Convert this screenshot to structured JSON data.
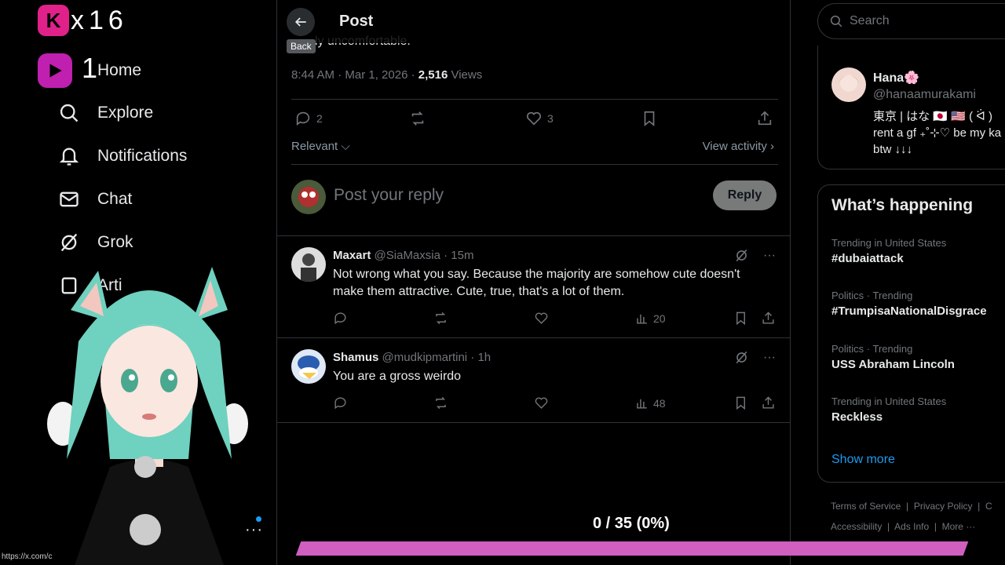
{
  "brand": {
    "letter": "K",
    "text": "x16",
    "badge_number": "1"
  },
  "nav": {
    "items": [
      {
        "label": "Home",
        "icon": "home-icon"
      },
      {
        "label": "Explore",
        "icon": "search-icon"
      },
      {
        "label": "Notifications",
        "icon": "bell-icon"
      },
      {
        "label": "Chat",
        "icon": "mail-icon"
      },
      {
        "label": "Grok",
        "icon": "grok-icon"
      },
      {
        "label": "Arti",
        "icon": "bookmark-icon"
      }
    ],
    "status_url": "https://x.com/c"
  },
  "header": {
    "title": "Post",
    "back_tooltip": "Back",
    "partial_text": "ly uncomfortable."
  },
  "post": {
    "time": "8:44 AM · Mar 1, 2026",
    "views": "2,516",
    "views_label": "Views",
    "replies": "2",
    "likes": "3",
    "sort_label": "Relevant",
    "view_activity": "View activity"
  },
  "reply_box": {
    "placeholder": "Post your reply",
    "button": "Reply"
  },
  "replies": [
    {
      "name": "Maxart",
      "handle": "@SiaMaxsia",
      "time": "15m",
      "text": "Not wrong what you say. Because the majority are somehow cute  doesn't make them attractive. Cute, true, that's a lot of them.",
      "views": "20"
    },
    {
      "name": "Shamus",
      "handle": "@mudkipmartini",
      "time": "1h",
      "text": "You are a gross weirdo",
      "views": "48"
    }
  ],
  "search": {
    "placeholder": "Search"
  },
  "profile_card": {
    "name": "Hana🌸",
    "handle": "@hanaamurakami",
    "bio": "東京 | はな 🇯🇵 🇺🇸 ( ᐛ )\nrent a gf ₊˚⊹♡ be my ka\nbtw ↓↓↓"
  },
  "trends": {
    "title": "What’s happening",
    "items": [
      {
        "context": "Trending in United States",
        "topic": "#dubaiattack"
      },
      {
        "context": "Politics · Trending",
        "topic": "#TrumpisaNationalDisgrace"
      },
      {
        "context": "Politics · Trending",
        "topic": "USS Abraham Lincoln"
      },
      {
        "context": "Trending in United States",
        "topic": "Reckless"
      }
    ],
    "show_more": "Show more"
  },
  "footer": {
    "line1": [
      "Terms of Service",
      "Privacy Policy",
      "C"
    ],
    "line2": [
      "Accessibility",
      "Ads Info",
      "More ···"
    ]
  },
  "progress": {
    "label": "0 / 35 (0%)",
    "fraction": 0.0
  },
  "colors": {
    "accent": "#1d9bf0",
    "progress_bar": "#d05fc0",
    "brand_pink": "#e0218a"
  }
}
